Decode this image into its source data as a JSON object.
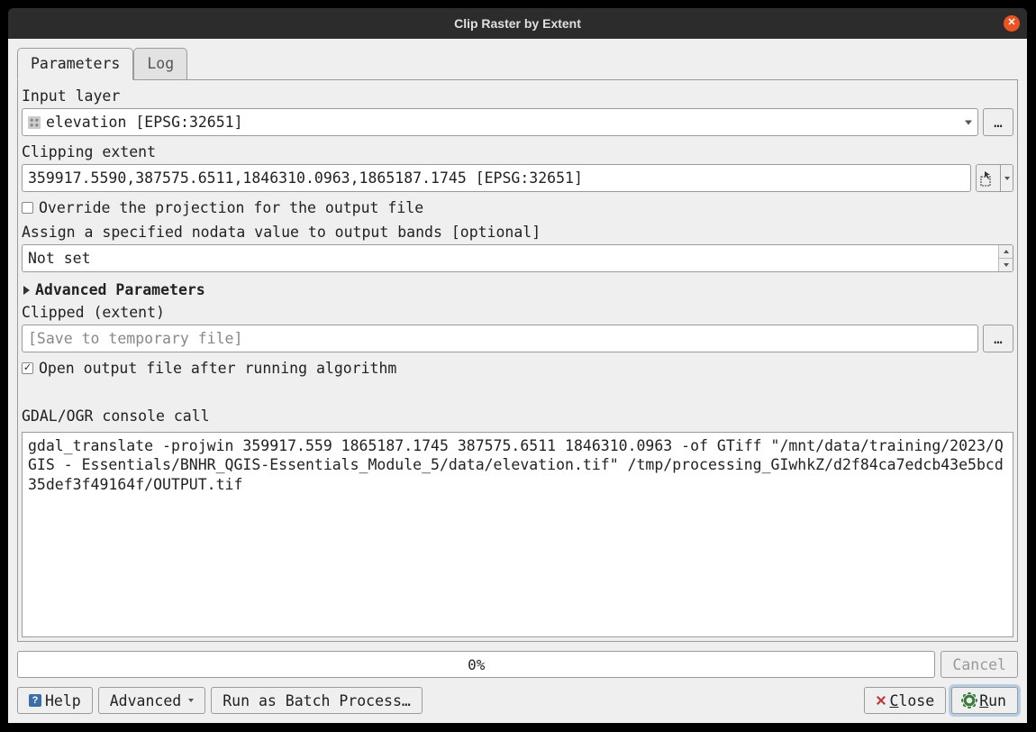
{
  "title": "Clip Raster by Extent",
  "tabs": {
    "parameters": "Parameters",
    "log": "Log"
  },
  "labels": {
    "input_layer": "Input layer",
    "clipping_extent": "Clipping extent",
    "override_projection": "Override the projection for the output file",
    "nodata": "Assign a specified nodata value to output bands [optional]",
    "advanced": "Advanced Parameters",
    "clipped_extent": "Clipped (extent)",
    "open_output": "Open output file after running algorithm",
    "console_call": "GDAL/OGR console call"
  },
  "values": {
    "input_layer": "elevation [EPSG:32651]",
    "clipping_extent": "359917.5590,387575.6511,1846310.0963,1865187.1745 [EPSG:32651]",
    "nodata": "Not set",
    "clipped_placeholder": "[Save to temporary file]",
    "console": "gdal_translate -projwin 359917.559 1865187.1745 387575.6511 1846310.0963 -of GTiff \"/mnt/data/training/2023/QGIS - Essentials/BNHR_QGIS-Essentials_Module_5/data/elevation.tif\" /tmp/processing_GIwhkZ/d2f84ca7edcb43e5bcd35def3f49164f/OUTPUT.tif"
  },
  "checkboxes": {
    "override_projection": false,
    "open_output": true
  },
  "progress": "0%",
  "buttons": {
    "cancel": "Cancel",
    "help": "Help",
    "advanced": "Advanced",
    "batch": "Run as Batch Process…",
    "close": "lose",
    "close_prefix": "C",
    "run": "un",
    "run_prefix": "R",
    "browse": "…"
  }
}
